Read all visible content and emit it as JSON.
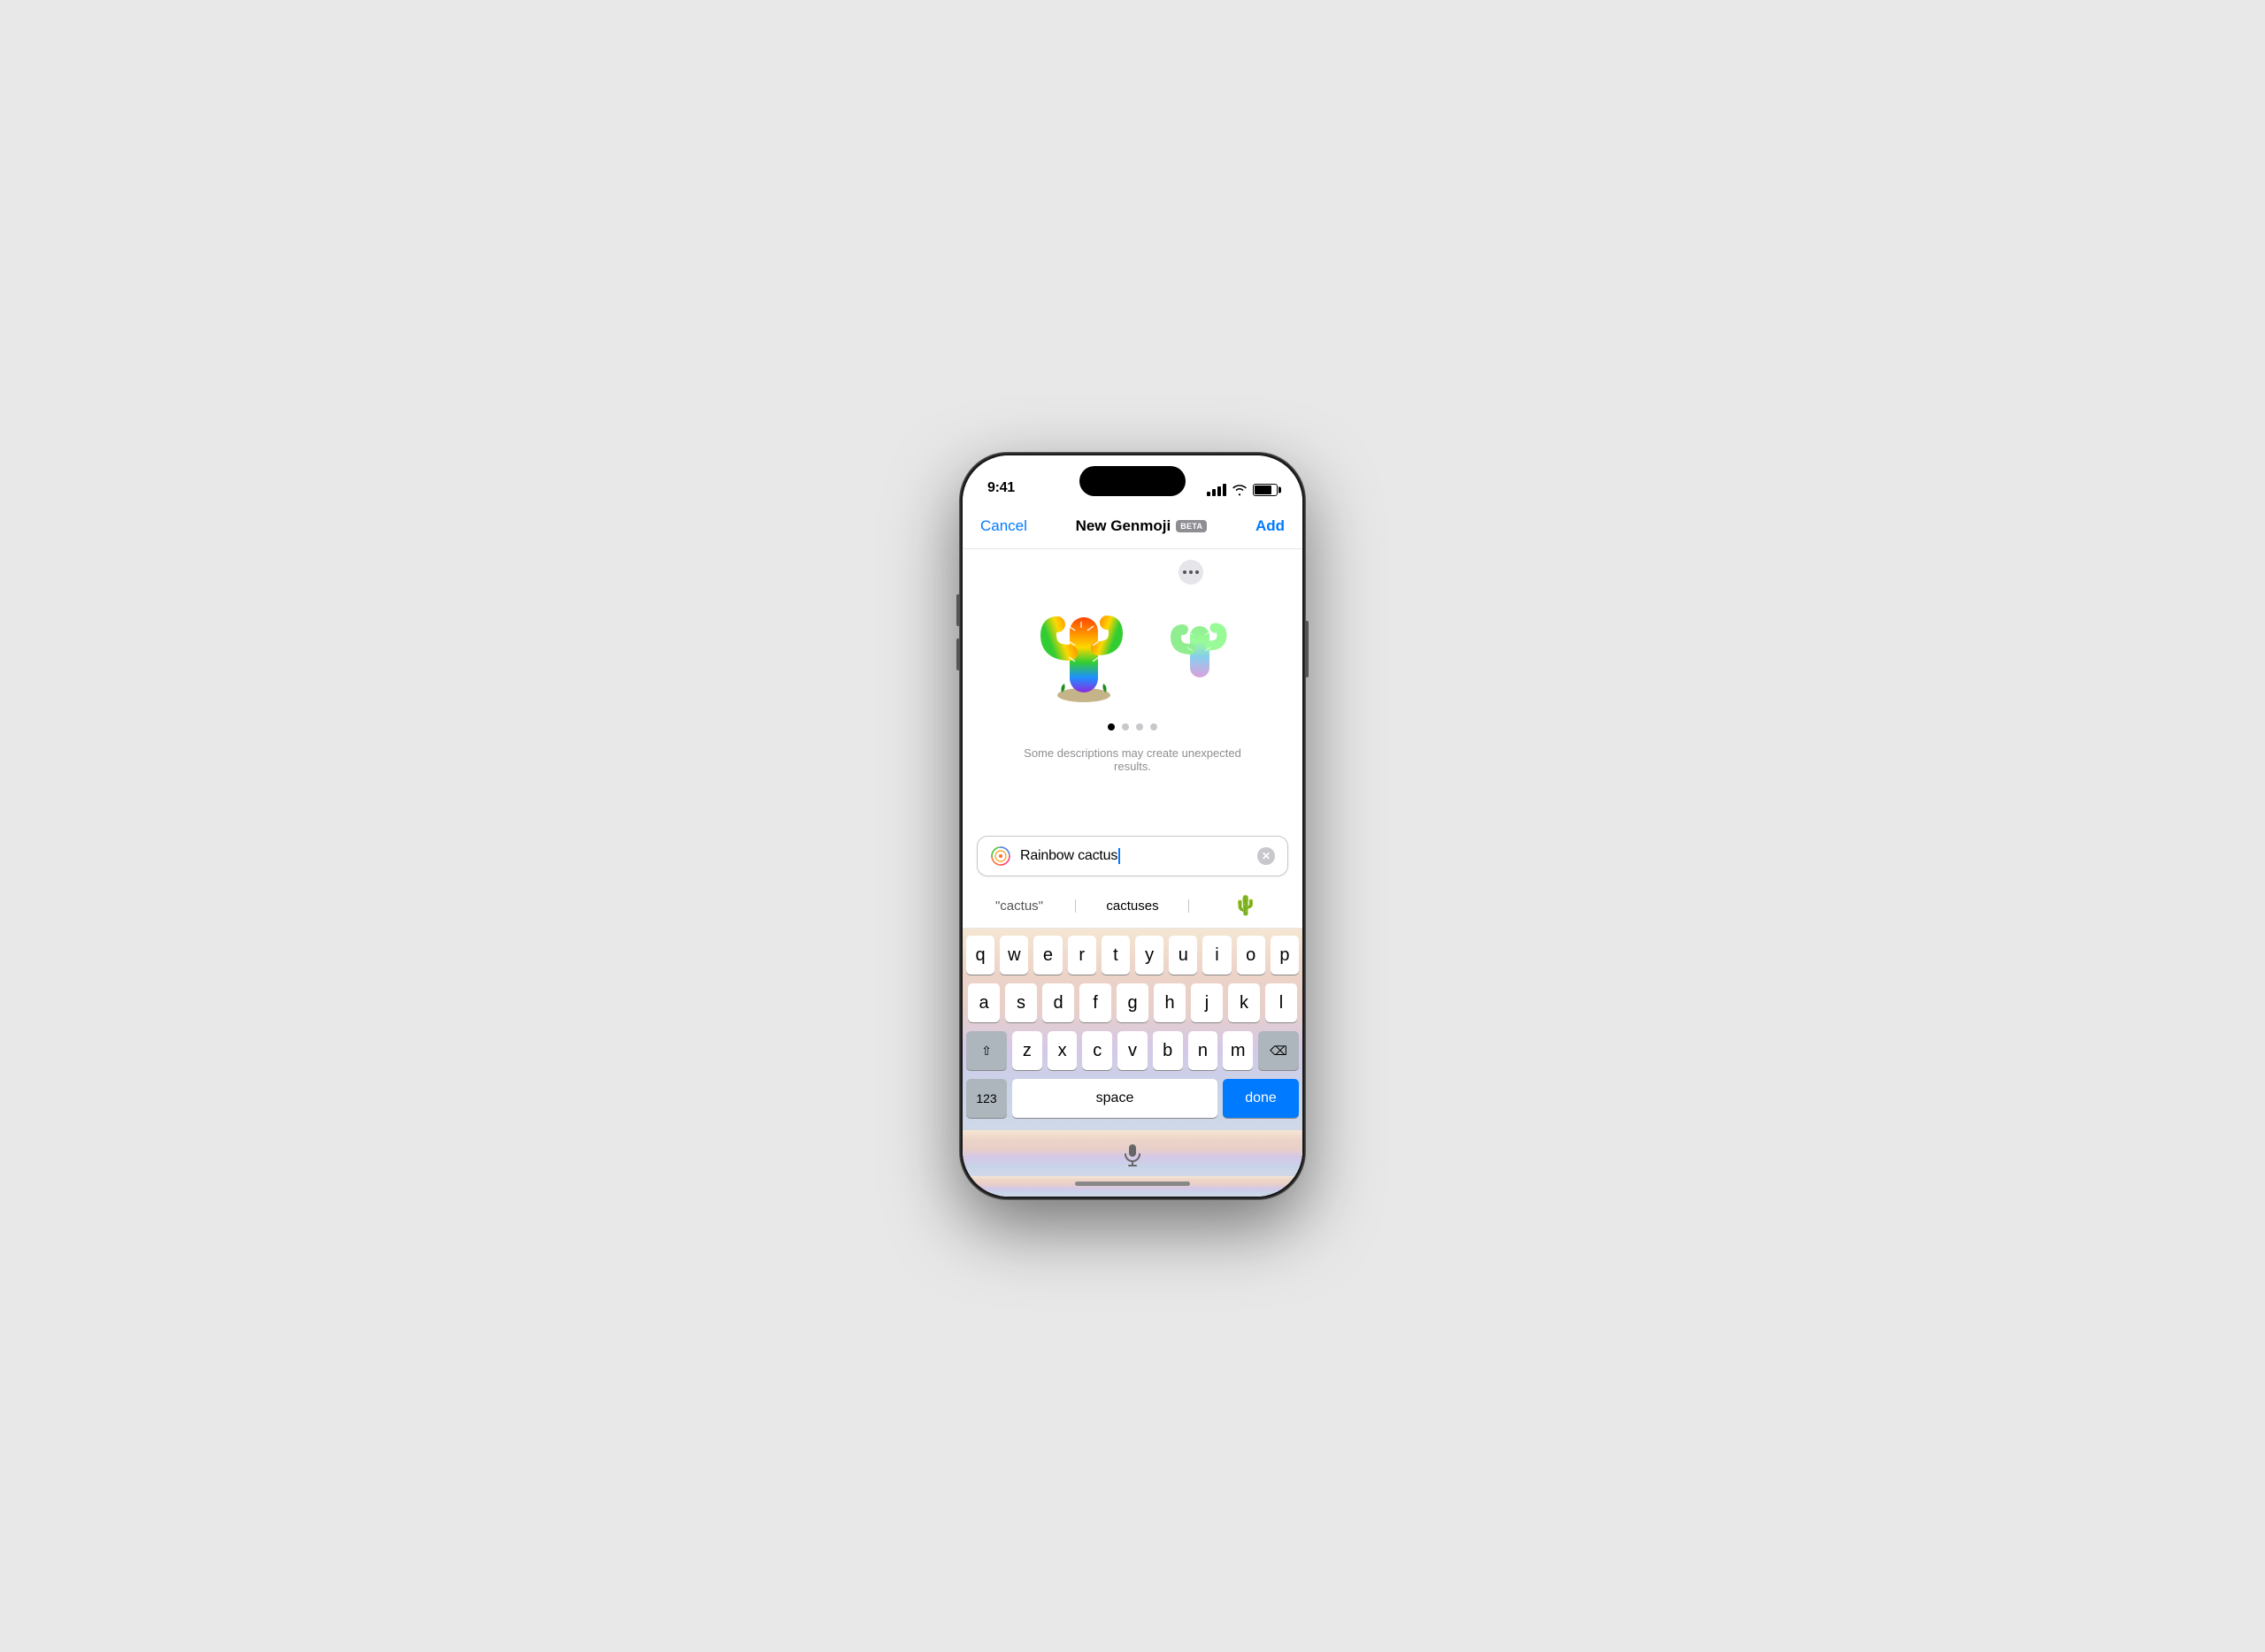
{
  "phone": {
    "status_bar": {
      "time": "9:41",
      "signal_label": "signal",
      "wifi_label": "wifi",
      "battery_label": "battery"
    },
    "nav": {
      "cancel_label": "Cancel",
      "title": "New Genmoji",
      "beta_label": "BETA",
      "add_label": "Add"
    },
    "content": {
      "more_button_label": "more options",
      "pagination_dots": [
        {
          "active": true
        },
        {
          "active": false
        },
        {
          "active": false
        },
        {
          "active": false
        }
      ],
      "warning_text": "Some descriptions may create unexpected results."
    },
    "search": {
      "value": "Rainbow cactus",
      "genmoji_icon_label": "genmoji-icon",
      "clear_label": "clear"
    },
    "autocomplete": {
      "items": [
        {
          "text": "\"cactus\"",
          "type": "text"
        },
        {
          "text": "cactuses",
          "type": "text"
        },
        {
          "text": "🌵",
          "type": "emoji"
        }
      ]
    },
    "keyboard": {
      "rows": [
        [
          "q",
          "w",
          "e",
          "r",
          "t",
          "y",
          "u",
          "i",
          "o",
          "p"
        ],
        [
          "a",
          "s",
          "d",
          "f",
          "g",
          "h",
          "j",
          "k",
          "l"
        ],
        [
          "z",
          "x",
          "c",
          "v",
          "b",
          "n",
          "m"
        ]
      ],
      "shift_label": "⇧",
      "backspace_label": "⌫",
      "numbers_label": "123",
      "space_label": "space",
      "done_label": "done"
    },
    "bottom": {
      "mic_label": "microphone",
      "home_bar_label": "home-indicator"
    }
  }
}
